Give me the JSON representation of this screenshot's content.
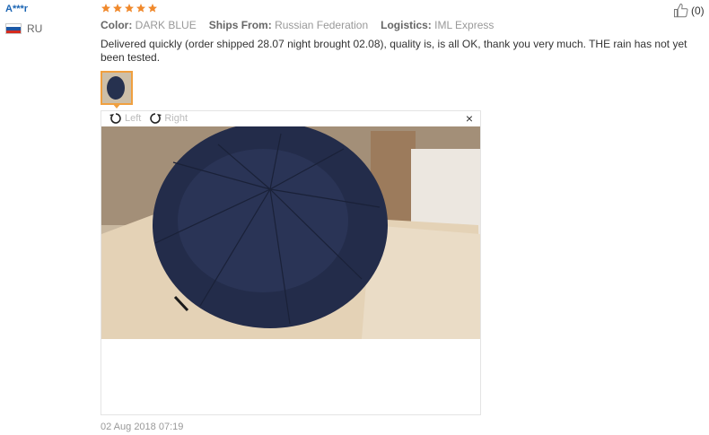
{
  "reviewer": {
    "name": "A***r",
    "country": "RU",
    "flag_colors": [
      "#ffffff",
      "#1c57a5",
      "#d52b1e"
    ]
  },
  "rating": {
    "stars": 5,
    "max": 5,
    "color": "#f0892c",
    "icon": "star-icon"
  },
  "helpful": {
    "count": "(0)",
    "icon": "thumbs-up-icon"
  },
  "meta": [
    {
      "key": "Color:",
      "value": "DARK BLUE"
    },
    {
      "key": "Ships From:",
      "value": "Russian Federation"
    },
    {
      "key": "Logistics:",
      "value": "IML Express"
    }
  ],
  "review_text": "Delivered quickly (order shipped 28.07 night brought 02.08), quality is, is all OK, thank you very much. THE rain has not yet been tested.",
  "viewer": {
    "rotate_left": "Left",
    "rotate_right": "Right",
    "close": "×",
    "photo_alt": "umbrella-photo"
  },
  "date": "02 Aug 2018 07:19"
}
